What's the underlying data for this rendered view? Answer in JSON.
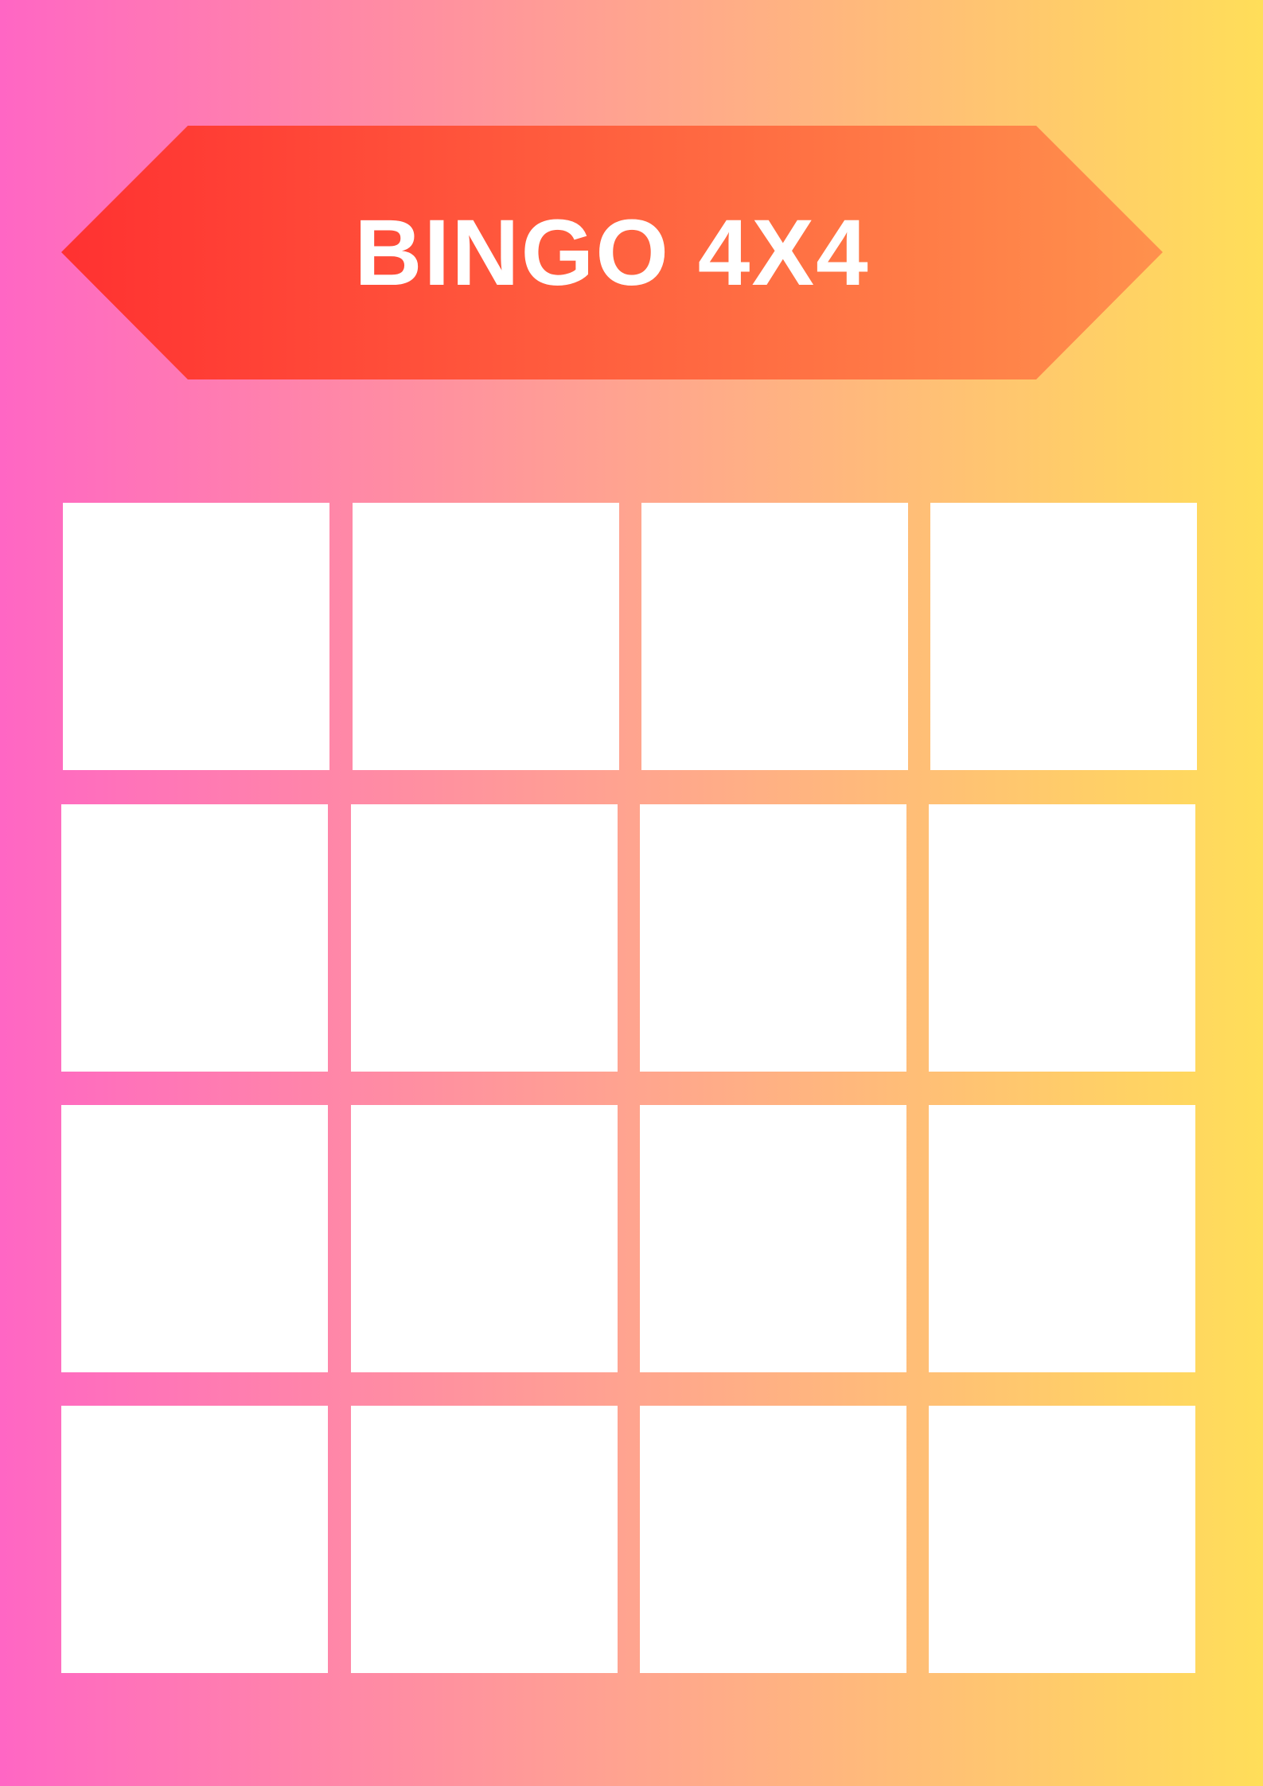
{
  "title": "BINGO 4X4",
  "colors": {
    "background_gradient": [
      "#ff66c4",
      "#ffa48f",
      "#ffde59"
    ],
    "banner_gradient": [
      "#ff3131",
      "#ff914d"
    ],
    "cell_fill": "#ffffff",
    "title_text": "#ffffff"
  },
  "grid": {
    "rows": 4,
    "columns": 4,
    "cells": [
      [
        "",
        "",
        "",
        ""
      ],
      [
        "",
        "",
        "",
        ""
      ],
      [
        "",
        "",
        "",
        ""
      ],
      [
        "",
        "",
        "",
        ""
      ]
    ]
  }
}
